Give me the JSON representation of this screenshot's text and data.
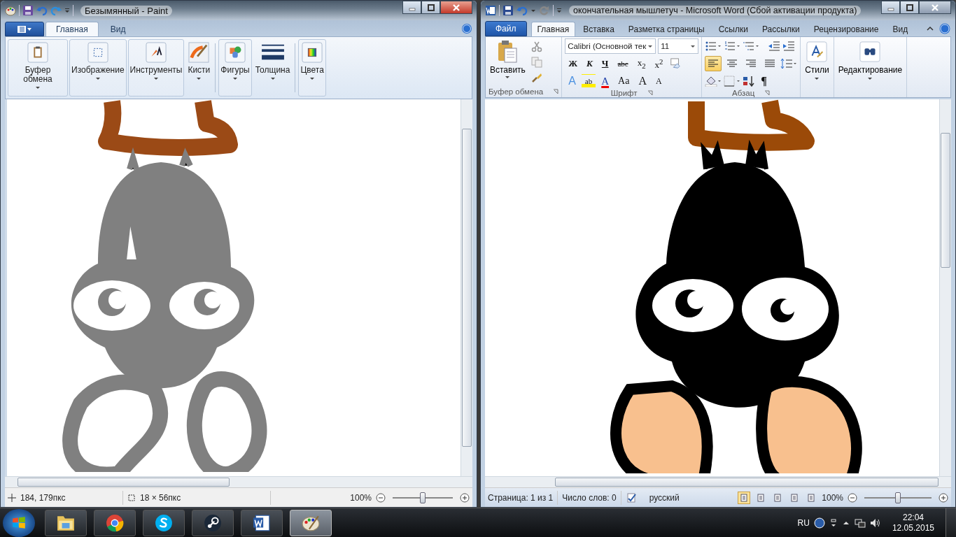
{
  "paint": {
    "title": "Безымянный - Paint",
    "tabs": [
      {
        "label": "Главная",
        "selected": true
      },
      {
        "label": "Вид",
        "selected": false
      }
    ],
    "groups": [
      {
        "label": "Буфер обмена",
        "kind": "clipboard"
      },
      {
        "label": "Изображение",
        "kind": "image"
      },
      {
        "label": "Инструменты",
        "kind": "tools"
      },
      {
        "label": "Кисти",
        "kind": "brushes"
      },
      {
        "label": "Фигуры",
        "kind": "shapes"
      },
      {
        "label": "Толщина",
        "kind": "size"
      },
      {
        "label": "Цвета",
        "kind": "colors"
      }
    ],
    "status": {
      "position": "184, 179пкс",
      "selection": "18 × 56пкс",
      "zoom": "100%",
      "zoom_slider": {
        "level": 0.5
      }
    }
  },
  "word": {
    "title": "окончательная мышлетуч  -  Microsoft Word (Сбой активации продукта)",
    "file_tab": "Файл",
    "tabs": [
      {
        "label": "Главная",
        "selected": true
      },
      {
        "label": "Вставка",
        "selected": false
      },
      {
        "label": "Разметка страницы",
        "selected": false
      },
      {
        "label": "Ссылки",
        "selected": false
      },
      {
        "label": "Рассылки",
        "selected": false
      },
      {
        "label": "Рецензирование",
        "selected": false
      },
      {
        "label": "Вид",
        "selected": false
      }
    ],
    "clipboard": {
      "paste": "Вставить",
      "group": "Буфер обмена"
    },
    "font": {
      "name": "Calibri (Основной тек",
      "size": "11",
      "group": "Шрифт",
      "row_1": [
        {
          "kind": "bold",
          "label": "Ж"
        },
        {
          "kind": "italic",
          "label": "К"
        },
        {
          "kind": "underline",
          "label": "Ч"
        },
        {
          "kind": "strike",
          "label": "abc"
        },
        {
          "kind": "plain",
          "label": "x$_{2}$"
        },
        {
          "kind": "plain",
          "label": "x$^{2}$"
        }
      ],
      "row_2": [
        {
          "kind": "effects",
          "label": "A"
        },
        {
          "kind": "highlight",
          "label": "ab"
        },
        {
          "kind": "color",
          "label": "A"
        },
        {
          "kind": "case",
          "label": "Aa"
        },
        {
          "kind": "grow",
          "label": "A"
        },
        {
          "kind": "shrink",
          "label": "A"
        }
      ]
    },
    "paragraph": {
      "group": "Абзац",
      "align": [
        {
          "selected": true
        },
        {
          "selected": false
        },
        {
          "selected": false
        },
        {
          "selected": false
        }
      ],
      "marks": "¶"
    },
    "styles": "Стили",
    "editing": "Редактирование",
    "status": {
      "page": "Страница: 1 из 1",
      "words": "Число слов: 0",
      "language": "русский",
      "views": [
        {
          "selected": true
        },
        {
          "selected": false
        },
        {
          "selected": false
        },
        {
          "selected": false
        },
        {
          "selected": false
        }
      ],
      "zoom": "100%",
      "zoom_slider": {
        "level": 0.5
      }
    }
  },
  "taskbar": {
    "apps": [
      {
        "kind": "folder",
        "selected": false
      },
      {
        "kind": "browser",
        "selected": false
      },
      {
        "kind": "skype",
        "selected": false
      },
      {
        "kind": "steam",
        "selected": false
      },
      {
        "kind": "word",
        "selected": false
      },
      {
        "kind": "paint",
        "selected": true
      }
    ],
    "language": "RU",
    "time": "22:04",
    "date": "12.05.2015"
  }
}
